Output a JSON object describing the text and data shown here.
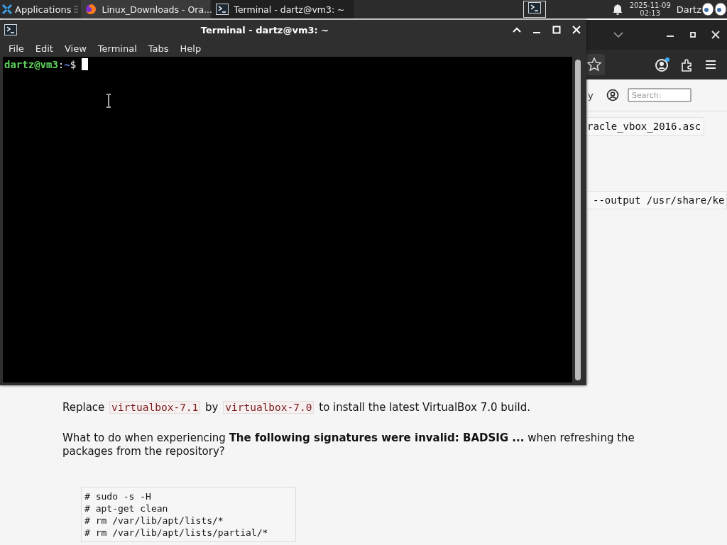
{
  "panel": {
    "apps_menu": {
      "label": "Applications"
    },
    "tasks": [
      {
        "label": "Linux_Downloads - Ora...",
        "kind": "browser",
        "selected": false
      },
      {
        "label": "Terminal - dartz@vm3: ~",
        "kind": "terminal",
        "selected": true
      }
    ],
    "clock": {
      "date": "2025-11-09",
      "time": "02:13"
    },
    "user": "Dartz"
  },
  "browser": {
    "nav_fragment": "y",
    "search": {
      "placeholder": "Search:"
    },
    "code_fragments": [
      "racle_vbox_2016.asc",
      "--output /usr/share/ke"
    ],
    "paragraphs": [
      [
        {
          "kind": "text",
          "text": "Replace "
        },
        {
          "kind": "code",
          "text": "virtualbox-7.1"
        },
        {
          "kind": "text",
          "text": " by "
        },
        {
          "kind": "code",
          "text": "virtualbox-7.0"
        },
        {
          "kind": "text",
          "text": " to install the latest VirtualBox 7.0 build."
        }
      ],
      [
        {
          "kind": "text",
          "text": "What to do when experiencing **The following signatures were invalid: BADSIG ...** when refreshing the packages from the repository?"
        }
      ]
    ],
    "code_block": [
      "# sudo -s -H",
      "# apt-get clean",
      "# rm /var/lib/apt/lists/*",
      "# rm /var/lib/apt/lists/partial/*"
    ]
  },
  "terminal": {
    "title": "Terminal - dartz@vm3: ~",
    "menu": [
      "File",
      "Edit",
      "View",
      "Terminal",
      "Tabs",
      "Help"
    ],
    "prompt": {
      "user_host": "dartz@vm3",
      "sep": ":",
      "path": "~",
      "symbol": "$"
    }
  }
}
